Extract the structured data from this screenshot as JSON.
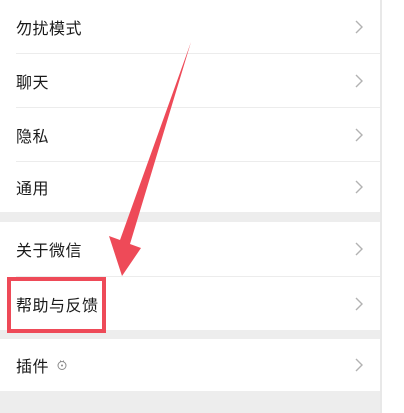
{
  "settings": {
    "items": [
      {
        "label": "勿扰模式"
      },
      {
        "label": "聊天"
      },
      {
        "label": "隐私"
      },
      {
        "label": "通用"
      },
      {
        "label": "关于微信"
      },
      {
        "label": "帮助与反馈"
      },
      {
        "label": "插件"
      }
    ]
  },
  "colors": {
    "background": "#ffffff",
    "section_gap": "#ededed",
    "text": "#1a1a1a",
    "chevron": "#b2b2b2",
    "annotation": "#ee4a58"
  },
  "icons": {
    "chevron": "chevron-right-icon",
    "plugin": "plugin-icon",
    "annotation_arrow": "arrow-annotation-icon"
  }
}
